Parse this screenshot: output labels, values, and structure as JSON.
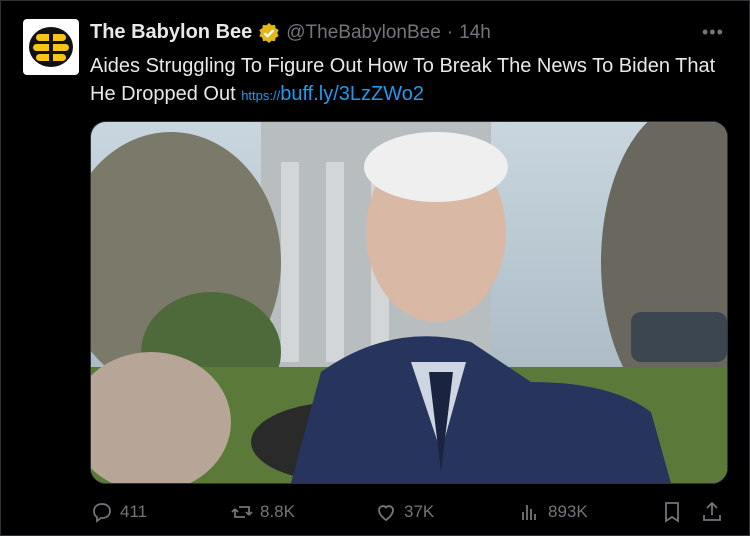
{
  "post": {
    "author_name": "The Babylon Bee",
    "handle": "@TheBabylonBee",
    "separator": "·",
    "time": "14h",
    "text": "Aides Struggling To Figure Out How To Break The News To Biden That He Dropped Out",
    "link_prefix": "https://",
    "link_text": "buff.ly/3LzZWo2"
  },
  "metrics": {
    "replies": "411",
    "reposts": "8.8K",
    "likes": "37K",
    "views": "893K"
  },
  "colors": {
    "background": "#000000",
    "text": "#e7e9ea",
    "muted": "#71767b",
    "link": "#1d9bf0",
    "verified_badge": "#e2b719",
    "avatar_yellow": "#f5c518"
  },
  "icons": [
    "verified-badge-icon",
    "more-icon",
    "reply-icon",
    "repost-icon",
    "like-icon",
    "views-icon",
    "bookmark-icon",
    "share-icon"
  ]
}
